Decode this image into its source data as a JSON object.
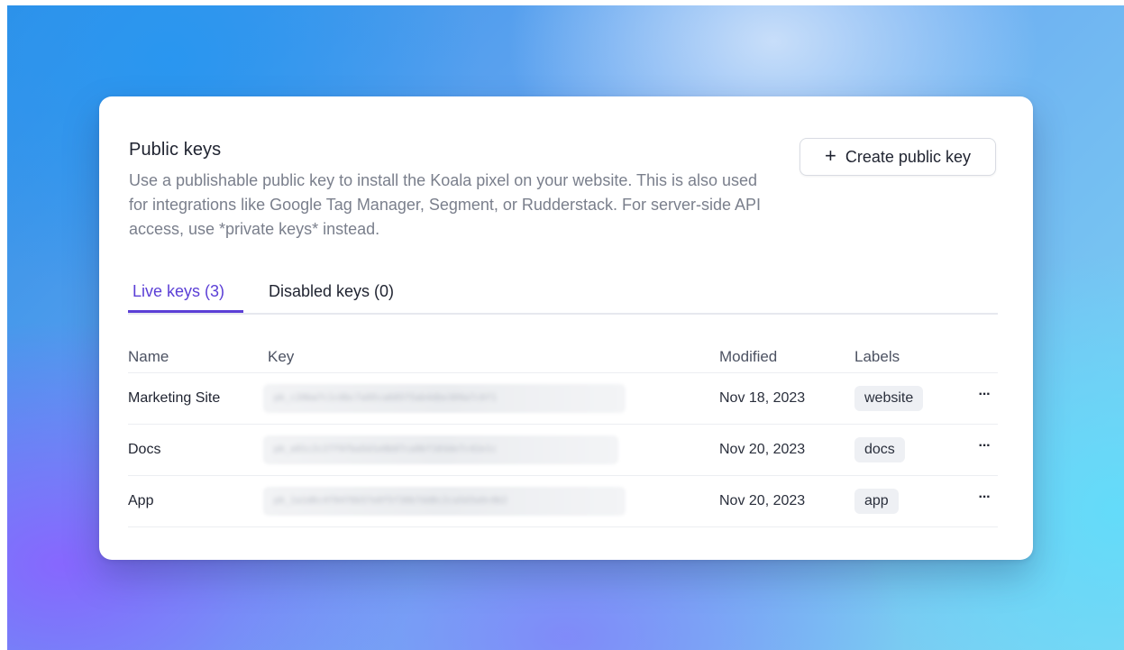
{
  "panel": {
    "title": "Public keys",
    "description": "Use a publishable public key to install the Koala pixel on your website. This is also used for integrations like Google Tag Manager, Segment, or Rudderstack. For server-side API access, use *private keys* instead.",
    "create_button_label": "Create public key",
    "create_button_icon": "plus-icon"
  },
  "tabs": [
    {
      "label": "Live keys (3)",
      "active": true
    },
    {
      "label": "Disabled keys (0)",
      "active": false
    }
  ],
  "table": {
    "columns": [
      "Name",
      "Key",
      "Modified",
      "Labels"
    ],
    "rows": [
      {
        "name": "Marketing Site",
        "key": "",
        "modified": "Nov 18, 2023",
        "label": "website",
        "menu": "···"
      },
      {
        "name": "Docs",
        "key": "",
        "modified": "Nov 20, 2023",
        "label": "docs",
        "menu": "···"
      },
      {
        "name": "App",
        "key": "",
        "modified": "Nov 20, 2023",
        "label": "app",
        "menu": "···"
      }
    ]
  },
  "colors": {
    "accent": "#5b3fd6",
    "text_primary": "#1f2330",
    "text_muted": "#7a7f8c",
    "label_bg": "#eef0f4"
  }
}
